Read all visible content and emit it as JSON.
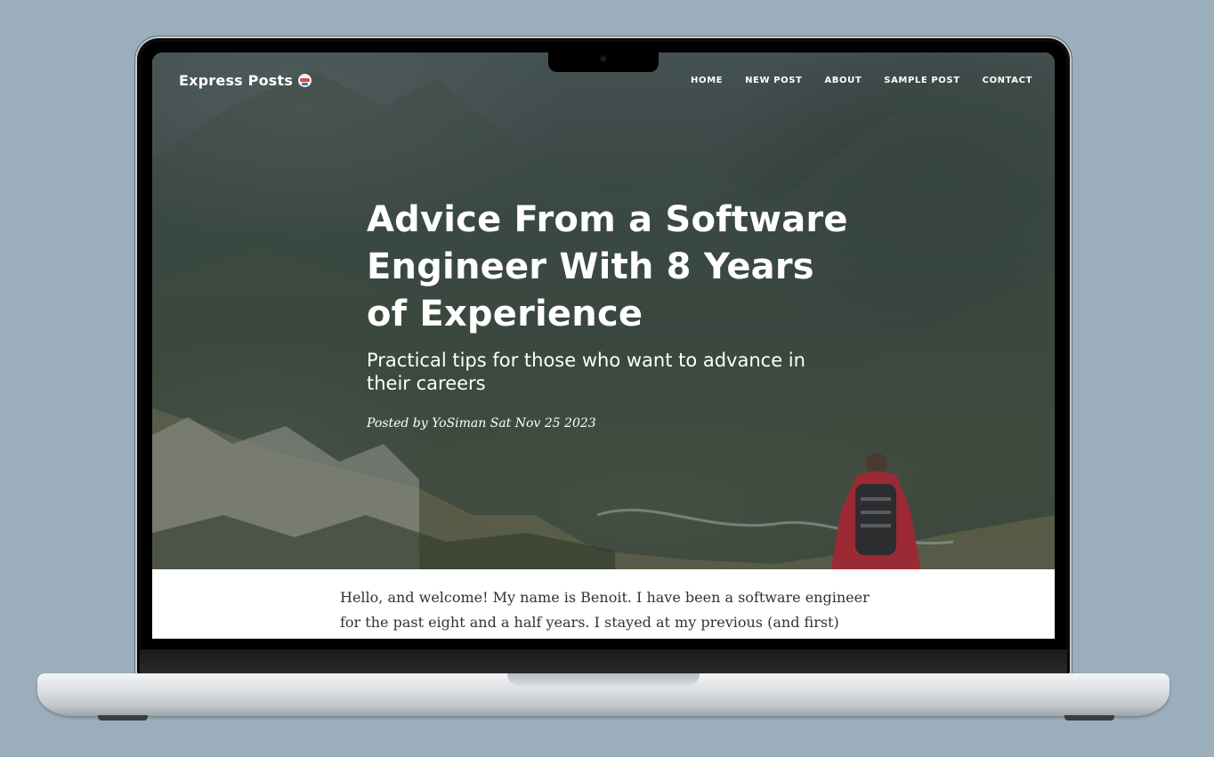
{
  "site": {
    "brand": "Express Posts",
    "brand_icon": "robot-emoji-icon"
  },
  "nav": {
    "items": [
      {
        "label": "HOME"
      },
      {
        "label": "NEW POST"
      },
      {
        "label": "ABOUT"
      },
      {
        "label": "SAMPLE POST"
      },
      {
        "label": "CONTACT"
      }
    ]
  },
  "post": {
    "title": "Advice From a Software Engineer With 8 Years of Experience",
    "subtitle": "Practical tips for those who want to advance in their careers",
    "meta": "Posted by YoSiman Sat Nov 25 2023",
    "body_preview": "Hello, and welcome! My name is Benoit. I have been a software engineer for the past eight and a half years. I stayed at my previous (and first)"
  },
  "colors": {
    "background": "#9aafbb",
    "text_on_hero": "#ffffff",
    "body_text": "#333333"
  }
}
